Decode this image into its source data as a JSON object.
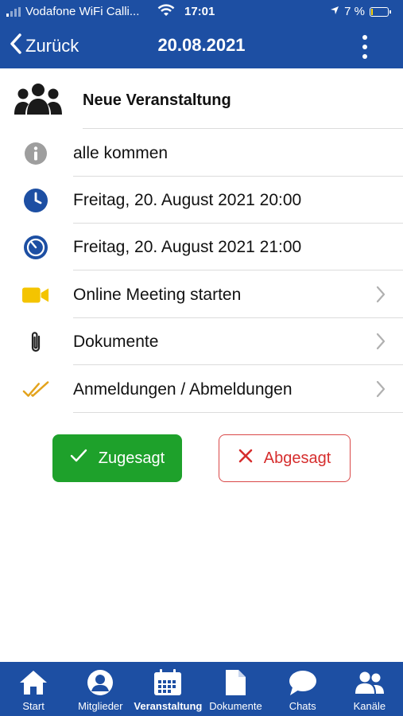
{
  "status": {
    "carrier": "Vodafone WiFi Calli...",
    "time": "17:01",
    "battery": "7 %"
  },
  "nav": {
    "back_label": "Zurück",
    "title": "20.08.2021"
  },
  "event": {
    "title": "Neue Veranstaltung",
    "rows": [
      {
        "icon": "info-icon",
        "label": "alle kommen"
      },
      {
        "icon": "clock-icon",
        "label": "Freitag, 20. August 2021 20:00"
      },
      {
        "icon": "timer-icon",
        "label": "Freitag, 20. August 2021 21:00"
      },
      {
        "icon": "video-camera-icon",
        "label": "Online Meeting starten"
      },
      {
        "icon": "paperclip-icon",
        "label": "Dokumente"
      },
      {
        "icon": "double-check-icon",
        "label": "Anmeldungen / Abmeldungen"
      }
    ]
  },
  "actions": {
    "accept_label": "Zugesagt",
    "decline_label": "Abgesagt"
  },
  "tabs": [
    {
      "icon": "home-icon",
      "label": "Start"
    },
    {
      "icon": "person-icon",
      "label": "Mitglieder"
    },
    {
      "icon": "calendar-icon",
      "label": "Veranstaltung",
      "active": true
    },
    {
      "icon": "document-icon",
      "label": "Dokumente"
    },
    {
      "icon": "chat-icon",
      "label": "Chats"
    },
    {
      "icon": "group-icon",
      "label": "Kanäle"
    }
  ],
  "colors": {
    "brand": "#1d4fa3",
    "accept": "#1ea12b",
    "decline": "#d62e2e",
    "video": "#f4c400",
    "check": "#e3a31c"
  }
}
